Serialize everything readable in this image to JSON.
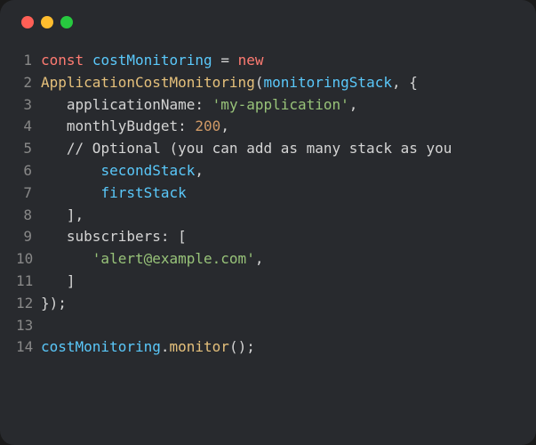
{
  "window": {
    "traffic_lights": [
      "close",
      "minimize",
      "maximize"
    ]
  },
  "code": {
    "lines": [
      {
        "num": "1",
        "tokens": [
          {
            "cls": "tok-keyword",
            "t": "const"
          },
          {
            "cls": "tok-punct",
            "t": " "
          },
          {
            "cls": "tok-var",
            "t": "costMonitoring"
          },
          {
            "cls": "tok-punct",
            "t": " "
          },
          {
            "cls": "tok-op",
            "t": "="
          },
          {
            "cls": "tok-punct",
            "t": " "
          },
          {
            "cls": "tok-keyword",
            "t": "new"
          }
        ]
      },
      {
        "num": "2",
        "tokens": [
          {
            "cls": "tok-class",
            "t": "ApplicationCostMonitoring"
          },
          {
            "cls": "tok-punct",
            "t": "("
          },
          {
            "cls": "tok-param",
            "t": "monitoringStack"
          },
          {
            "cls": "tok-punct",
            "t": ", {"
          }
        ]
      },
      {
        "num": "3",
        "tokens": [
          {
            "cls": "tok-punct",
            "t": "   "
          },
          {
            "cls": "tok-prop",
            "t": "applicationName"
          },
          {
            "cls": "tok-punct",
            "t": ": "
          },
          {
            "cls": "tok-string",
            "t": "'my-application'"
          },
          {
            "cls": "tok-punct",
            "t": ","
          }
        ]
      },
      {
        "num": "4",
        "tokens": [
          {
            "cls": "tok-punct",
            "t": "   "
          },
          {
            "cls": "tok-prop",
            "t": "monthlyBudget"
          },
          {
            "cls": "tok-punct",
            "t": ": "
          },
          {
            "cls": "tok-number",
            "t": "200"
          },
          {
            "cls": "tok-punct",
            "t": ","
          }
        ]
      },
      {
        "num": "5",
        "tokens": [
          {
            "cls": "tok-punct",
            "t": "   "
          },
          {
            "cls": "tok-comment",
            "t": "// Optional (you can add as many stack as you"
          }
        ]
      },
      {
        "num": "6",
        "tokens": [
          {
            "cls": "tok-punct",
            "t": "       "
          },
          {
            "cls": "tok-param",
            "t": "secondStack"
          },
          {
            "cls": "tok-punct",
            "t": ","
          }
        ]
      },
      {
        "num": "7",
        "tokens": [
          {
            "cls": "tok-punct",
            "t": "       "
          },
          {
            "cls": "tok-param",
            "t": "firstStack"
          }
        ]
      },
      {
        "num": "8",
        "tokens": [
          {
            "cls": "tok-punct",
            "t": "   ],"
          }
        ]
      },
      {
        "num": "9",
        "tokens": [
          {
            "cls": "tok-punct",
            "t": "   "
          },
          {
            "cls": "tok-prop",
            "t": "subscribers"
          },
          {
            "cls": "tok-punct",
            "t": ": ["
          }
        ]
      },
      {
        "num": "10",
        "tokens": [
          {
            "cls": "tok-punct",
            "t": "      "
          },
          {
            "cls": "tok-string",
            "t": "'alert@example.com'"
          },
          {
            "cls": "tok-punct",
            "t": ","
          }
        ]
      },
      {
        "num": "11",
        "tokens": [
          {
            "cls": "tok-punct",
            "t": "   ]"
          }
        ]
      },
      {
        "num": "12",
        "tokens": [
          {
            "cls": "tok-punct",
            "t": "});"
          }
        ]
      },
      {
        "num": "13",
        "tokens": []
      },
      {
        "num": "14",
        "tokens": [
          {
            "cls": "tok-var",
            "t": "costMonitoring"
          },
          {
            "cls": "tok-punct",
            "t": "."
          },
          {
            "cls": "tok-method",
            "t": "monitor"
          },
          {
            "cls": "tok-punct",
            "t": "();"
          }
        ]
      }
    ]
  }
}
